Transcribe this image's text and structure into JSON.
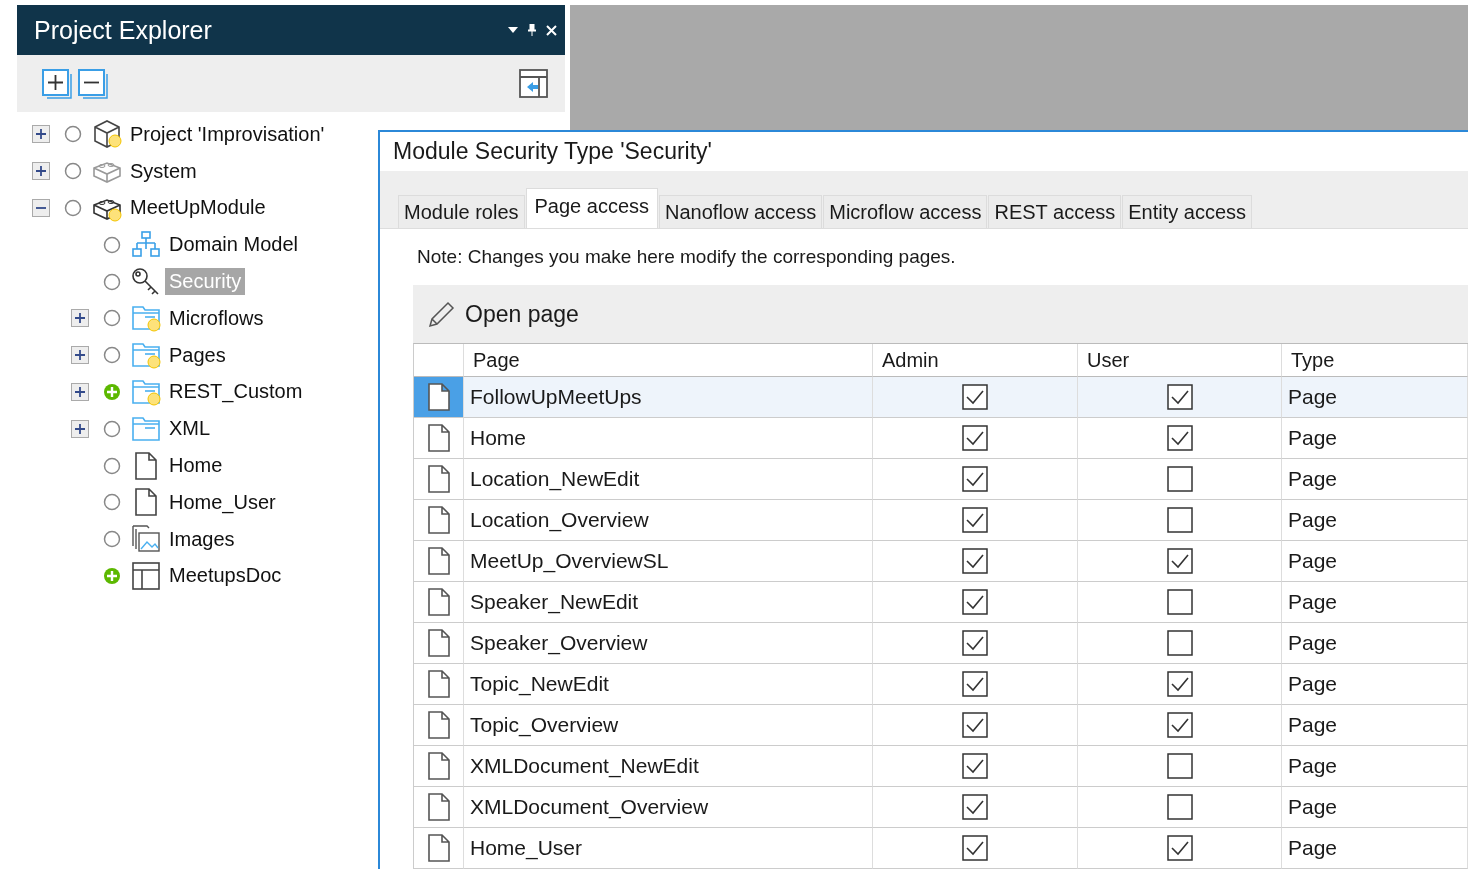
{
  "explorer": {
    "title": "Project Explorer",
    "tree": [
      {
        "label": "Project 'Improvisation'",
        "kind": "project",
        "expanded": false,
        "has_children": true,
        "added": false,
        "modified": true,
        "selected": false
      },
      {
        "label": "System",
        "kind": "module-gray",
        "expanded": false,
        "has_children": true,
        "added": false,
        "modified": false,
        "selected": false
      },
      {
        "label": "MeetUpModule",
        "kind": "module",
        "expanded": true,
        "has_children": true,
        "added": false,
        "modified": true,
        "selected": false,
        "children": [
          {
            "label": "Domain Model",
            "kind": "domain",
            "has_children": false,
            "added": false,
            "modified": false,
            "selected": false
          },
          {
            "label": "Security",
            "kind": "security",
            "has_children": false,
            "added": false,
            "modified": false,
            "selected": true
          },
          {
            "label": "Microflows",
            "kind": "folder",
            "expanded": false,
            "has_children": true,
            "added": false,
            "modified": true,
            "selected": false
          },
          {
            "label": "Pages",
            "kind": "folder",
            "expanded": false,
            "has_children": true,
            "added": false,
            "modified": true,
            "selected": false
          },
          {
            "label": "REST_Custom",
            "kind": "folder",
            "expanded": false,
            "has_children": true,
            "added": true,
            "modified": true,
            "selected": false
          },
          {
            "label": "XML",
            "kind": "folder",
            "expanded": false,
            "has_children": true,
            "added": false,
            "modified": false,
            "selected": false
          },
          {
            "label": "Home",
            "kind": "page",
            "has_children": false,
            "added": false,
            "modified": false,
            "selected": false
          },
          {
            "label": "Home_User",
            "kind": "page",
            "has_children": false,
            "added": false,
            "modified": false,
            "selected": false
          },
          {
            "label": "Images",
            "kind": "images",
            "has_children": false,
            "added": false,
            "modified": false,
            "selected": false
          },
          {
            "label": "MeetupsDoc",
            "kind": "document",
            "has_children": false,
            "added": true,
            "modified": false,
            "selected": false
          }
        ]
      }
    ]
  },
  "dialog": {
    "title": "Module Security Type 'Security'",
    "tabs": [
      {
        "label": "Module roles",
        "selected": false
      },
      {
        "label": "Page access",
        "selected": true
      },
      {
        "label": "Nanoflow access",
        "selected": false
      },
      {
        "label": "Microflow access",
        "selected": false
      },
      {
        "label": "REST access",
        "selected": false
      },
      {
        "label": "Entity access",
        "selected": false
      }
    ],
    "note": "Note: Changes you make here modify the corresponding pages.",
    "toolbar": {
      "open_button": "Open page"
    },
    "table": {
      "columns": [
        "Page",
        "Admin",
        "User",
        "Type"
      ],
      "rows": [
        {
          "page": "FollowUpMeetUps",
          "admin": true,
          "user": true,
          "type": "Page",
          "selected": true
        },
        {
          "page": "Home",
          "admin": true,
          "user": true,
          "type": "Page",
          "selected": false
        },
        {
          "page": "Location_NewEdit",
          "admin": true,
          "user": false,
          "type": "Page",
          "selected": false
        },
        {
          "page": "Location_Overview",
          "admin": true,
          "user": false,
          "type": "Page",
          "selected": false
        },
        {
          "page": "MeetUp_OverviewSL",
          "admin": true,
          "user": true,
          "type": "Page",
          "selected": false
        },
        {
          "page": "Speaker_NewEdit",
          "admin": true,
          "user": false,
          "type": "Page",
          "selected": false
        },
        {
          "page": "Speaker_Overview",
          "admin": true,
          "user": false,
          "type": "Page",
          "selected": false
        },
        {
          "page": "Topic_NewEdit",
          "admin": true,
          "user": true,
          "type": "Page",
          "selected": false
        },
        {
          "page": "Topic_Overview",
          "admin": true,
          "user": true,
          "type": "Page",
          "selected": false
        },
        {
          "page": "XMLDocument_NewEdit",
          "admin": true,
          "user": false,
          "type": "Page",
          "selected": false
        },
        {
          "page": "XMLDocument_Overview",
          "admin": true,
          "user": false,
          "type": "Page",
          "selected": false
        },
        {
          "page": "Home_User",
          "admin": true,
          "user": true,
          "type": "Page",
          "selected": false
        }
      ]
    }
  }
}
